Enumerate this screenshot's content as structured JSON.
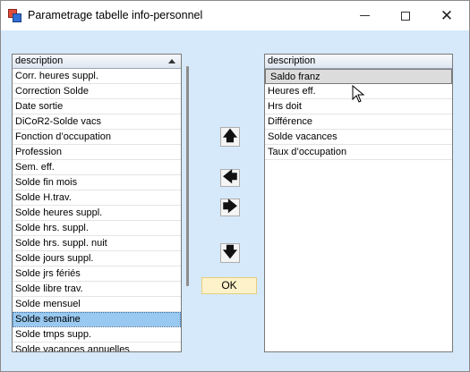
{
  "window": {
    "title": "Parametrage tabelle info-personnel",
    "icon": "app-form-icon",
    "controls": {
      "minimize": "minimize-icon",
      "maximize": "maximize-icon",
      "close": "close-icon"
    }
  },
  "left_list": {
    "header": "description",
    "sort_icon": "sort-ascending-icon",
    "items": [
      "Corr. heures suppl.",
      "Correction Solde",
      "Date sortie",
      "DiCoR2-Solde vacs",
      "Fonction d’occupation",
      "Profession",
      "Sem. eff.",
      "Solde fin mois",
      "Solde H.trav.",
      "Solde heures suppl.",
      "Solde hrs. suppl.",
      "Solde hrs. suppl. nuit",
      "Solde jours suppl.",
      "Solde jrs fériés",
      "Solde libre trav.",
      "Solde mensuel",
      "Solde semaine",
      "Solde tmps supp.",
      "Solde vacances annuelles"
    ],
    "selected_index": 16
  },
  "right_list": {
    "header": "description",
    "items": [
      "Saldo franz",
      "Heures eff.",
      "Hrs doit",
      "Différence",
      "Solde vacances",
      "Taux d’occupation"
    ],
    "selected_index": 0
  },
  "buttons": {
    "move_up": "arrow-up-icon",
    "move_left": "arrow-left-icon",
    "move_right": "arrow-right-icon",
    "move_down": "arrow-down-icon",
    "ok_label": "OK"
  },
  "colors": {
    "window_bg": "#d6e9fb",
    "selection": "#99c9f0",
    "ok_button_bg": "#fdf2c9"
  }
}
